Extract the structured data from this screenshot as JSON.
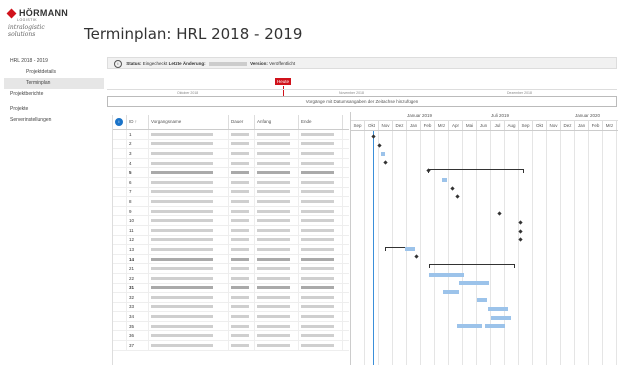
{
  "brand": {
    "name": "HÖRMANN",
    "sub": "LOGISTIK",
    "script": "intralogistic solutions"
  },
  "page_title": "Terminplan: HRL 2018 - 2019",
  "sidebar": [
    {
      "label": "HRL 2018 - 2019",
      "sub": false,
      "active": false
    },
    {
      "label": "Projektdetails",
      "sub": true,
      "active": false
    },
    {
      "label": "Terminplan",
      "sub": true,
      "active": true
    },
    {
      "label": "Projektberichte",
      "sub": false,
      "active": false
    },
    {
      "label": "Projekte",
      "sub": false,
      "active": false
    },
    {
      "label": "Serverinstellungen",
      "sub": false,
      "active": false
    }
  ],
  "status_bar": {
    "status_label": "Status:",
    "status_value": "Eingecheckt",
    "change_label": "Letzte Änderung:",
    "version_label": "Version:",
    "version_value": "Veröffentlicht"
  },
  "timeline": {
    "today_label": "Heute",
    "ruler_labels": [
      "Oktober 2018",
      "November 2018",
      "Dezember 2018"
    ],
    "drop_hint": "Vorgänge mit Datumsangaben der Zeitachse hinzufügen"
  },
  "table": {
    "headers": [
      "",
      "ID ↑",
      "Vorgangsname",
      "Dauer",
      "Anfang",
      "Ende"
    ],
    "rows": [
      {
        "id": "1",
        "summary": false
      },
      {
        "id": "2",
        "summary": false
      },
      {
        "id": "3",
        "summary": false
      },
      {
        "id": "4",
        "summary": false
      },
      {
        "id": "5",
        "summary": true
      },
      {
        "id": "6",
        "summary": false
      },
      {
        "id": "7",
        "summary": false
      },
      {
        "id": "8",
        "summary": false
      },
      {
        "id": "9",
        "summary": false
      },
      {
        "id": "10",
        "summary": false
      },
      {
        "id": "11",
        "summary": false
      },
      {
        "id": "12",
        "summary": false
      },
      {
        "id": "13",
        "summary": false
      },
      {
        "id": "14",
        "summary": true
      },
      {
        "id": "21",
        "summary": false
      },
      {
        "id": "22",
        "summary": false
      },
      {
        "id": "31",
        "summary": true
      },
      {
        "id": "32",
        "summary": false
      },
      {
        "id": "33",
        "summary": false
      },
      {
        "id": "34",
        "summary": false
      },
      {
        "id": "35",
        "summary": false
      },
      {
        "id": "36",
        "summary": false
      },
      {
        "id": "37",
        "summary": false
      }
    ]
  },
  "gantt": {
    "years": [
      {
        "label": "Januar 2019"
      },
      {
        "label": "Juli 2019"
      },
      {
        "label": "Januar 2020"
      }
    ],
    "months": [
      "Sep",
      "Okt",
      "Nov",
      "Dez",
      "Jan",
      "Feb",
      "Mrz",
      "Apr",
      "Mai",
      "Jun",
      "Jul",
      "Aug",
      "Sep",
      "Okt",
      "Nov",
      "Dez",
      "Jan",
      "Feb",
      "Mrz",
      "Apr"
    ]
  }
}
